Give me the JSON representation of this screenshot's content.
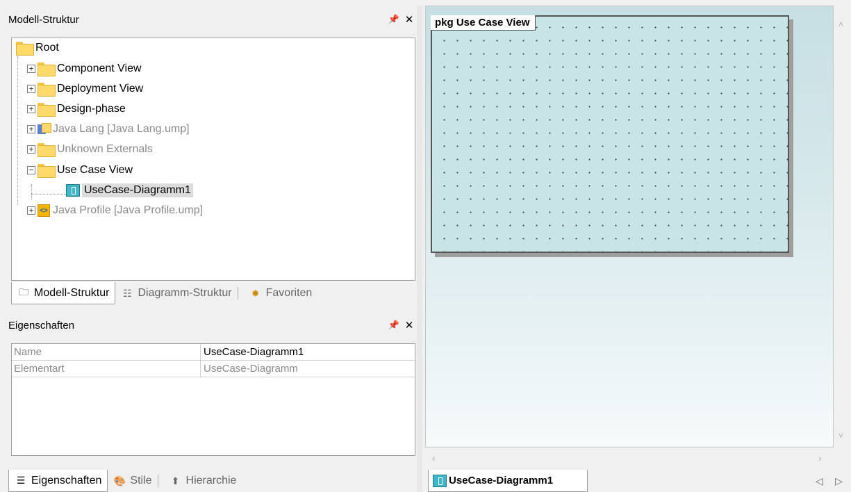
{
  "model_panel": {
    "title": "Modell-Struktur",
    "pin": "4",
    "close": "✕",
    "tree": [
      {
        "label": "Root",
        "expander": ""
      },
      {
        "label": "Component View",
        "expander": "+"
      },
      {
        "label": "Deployment View",
        "expander": "+"
      },
      {
        "label": "Design-phase",
        "expander": "+"
      },
      {
        "label": "Java Lang [Java Lang.ump]",
        "expander": "+"
      },
      {
        "label": "Unknown Externals",
        "expander": "+"
      },
      {
        "label": "Use Case View",
        "expander": "−"
      },
      {
        "label": "UseCase-Diagramm1",
        "expander": ""
      },
      {
        "label": "Java Profile [Java Profile.ump]",
        "expander": "+"
      }
    ],
    "tabs": [
      "Modell-Struktur",
      "Diagramm-Struktur",
      "Favoriten"
    ]
  },
  "props_panel": {
    "title": "Eigenschaften",
    "rows": [
      {
        "key": "Name",
        "value": "UseCase-Diagramm1"
      },
      {
        "key": "Elementart",
        "value": "UseCase-Diagramm"
      }
    ],
    "tabs": [
      "Eigenschaften",
      "Stile",
      "Hierarchie"
    ]
  },
  "diagram": {
    "frame_label": "pkg Use Case View",
    "tab_label": "UseCase-Diagramm1"
  },
  "colors": {
    "canvas_top": "#c6dfe3",
    "folder": "#ffd969",
    "diagram_icon": "#3fb5c8"
  }
}
